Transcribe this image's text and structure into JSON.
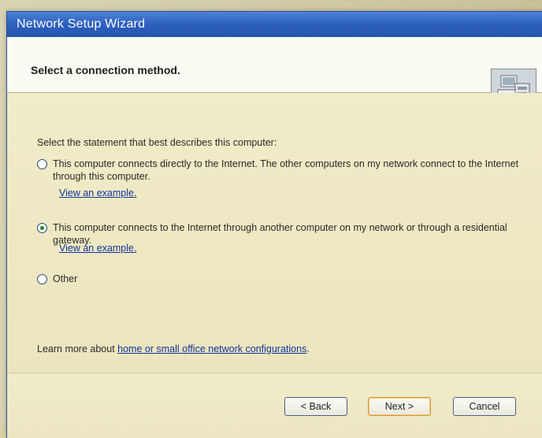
{
  "window": {
    "title": "Network Setup Wizard"
  },
  "header": {
    "heading": "Select a connection method."
  },
  "content": {
    "prompt": "Select the statement that best describes this computer:",
    "options": [
      {
        "label": "This computer connects directly to the Internet. The other computers on my network connect to the Internet through this computer.",
        "link": "View an example.",
        "selected": false
      },
      {
        "label": "This computer connects to the Internet through another computer on my network or through a residential gateway.",
        "link": "View an example.",
        "selected": true
      },
      {
        "label": "Other",
        "selected": false
      }
    ],
    "learn_prefix": "Learn more about ",
    "learn_link": "home or small office network configurations",
    "learn_suffix": "."
  },
  "buttons": {
    "back": "< Back",
    "next": "Next >",
    "cancel": "Cancel"
  },
  "colors": {
    "titlebar": "#2f62c1",
    "link": "#12349c",
    "selected_radio": "#1e8a1e"
  },
  "icons": {
    "header": "network-computers-icon"
  }
}
